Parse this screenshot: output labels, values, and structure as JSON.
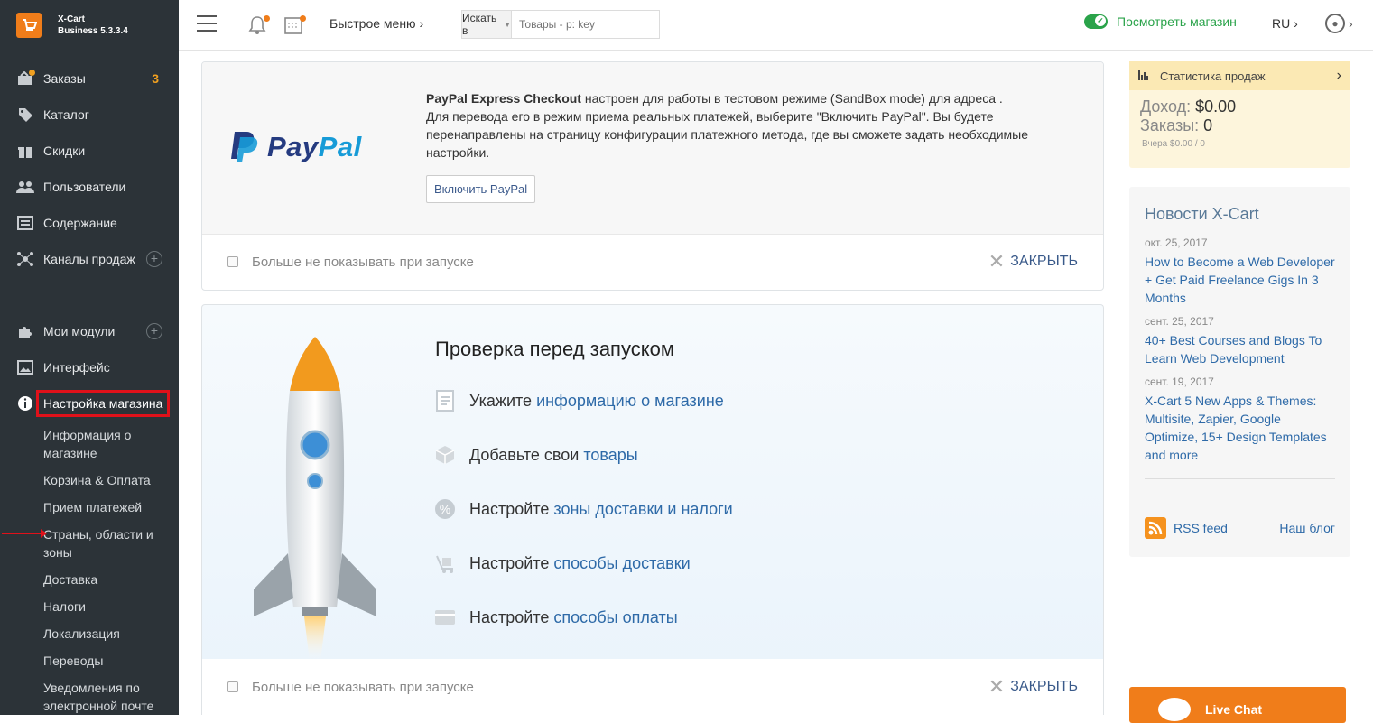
{
  "brand": {
    "name": "X-Cart",
    "edition": "Business 5.3.3.4"
  },
  "sidebar": {
    "items": [
      {
        "label": "Заказы",
        "badge": "3"
      },
      {
        "label": "Каталог"
      },
      {
        "label": "Скидки"
      },
      {
        "label": "Пользователи"
      },
      {
        "label": "Содержание"
      },
      {
        "label": "Каналы продаж"
      },
      {
        "label": "Мои модули"
      },
      {
        "label": "Интерфейс"
      },
      {
        "label": "Настройка магазина"
      }
    ],
    "subitems": [
      "Информация о магазине",
      "Корзина & Оплата",
      "Прием платежей",
      "Страны, области и зоны",
      "Доставка",
      "Налоги",
      "Локализация",
      "Переводы",
      "Уведомления по электронной почте"
    ]
  },
  "header": {
    "quick_menu": "Быстрое меню ›",
    "search_scope": "Искать в",
    "search_placeholder": "Товары - p: key",
    "view_store": "Посмотреть магазин",
    "lang": "RU ›"
  },
  "paypal": {
    "logo_pay": "Pay",
    "logo_pal": "Pal",
    "bold": "PayPal Express Checkout",
    "text": " настроен для работы в тестовом режиме (SandBox mode) для адреса .",
    "text2": "Для перевода его в режим приема реальных платежей, выберите \"Включить PayPal\". Вы будете перенаправлены на страницу конфигурации платежного метода, где вы сможете задать необходимые настройки.",
    "button": "Включить PayPal",
    "dont_show": "Больше не показывать при запуске",
    "close": "ЗАКРЫТЬ"
  },
  "launch": {
    "title": "Проверка перед запуском",
    "steps": [
      {
        "text": "Укажите",
        "link": "информацию о магазине"
      },
      {
        "text": "Добавьте свои",
        "link": "товары"
      },
      {
        "text": "Настройте",
        "link": "зоны доставки и налоги"
      },
      {
        "text": "Настройте",
        "link": "способы доставки"
      },
      {
        "text": "Настройте",
        "link": "способы оплаты"
      }
    ],
    "dont_show": "Больше не показывать при запуске",
    "close": "ЗАКРЫТЬ"
  },
  "stats": {
    "title": "Статистика продаж",
    "income_label": "Доход:",
    "income": "$0.00",
    "orders_label": "Заказы:",
    "orders": "0",
    "yesterday": "Вчера $0.00 / 0"
  },
  "news": {
    "title": "Новости X-Cart",
    "items": [
      {
        "date": "окт. 25, 2017",
        "title": "How to Become a Web Developer + Get Paid Freelance Gigs In 3 Months"
      },
      {
        "date": "сент. 25, 2017",
        "title": "40+ Best Courses and Blogs To Learn Web Development"
      },
      {
        "date": "сент. 19, 2017",
        "title": "X-Cart 5 New Apps & Themes: Multisite, Zapier, Google Optimize, 15+ Design Templates and more"
      }
    ],
    "rss": "RSS feed",
    "blog": "Наш блог"
  },
  "livechat": "Live Chat",
  "colors": {
    "sidebar": "#2c3338",
    "accent": "#f07d1a",
    "link": "#2e6aa8",
    "green": "#2aa34a",
    "highlight": "#e0111a"
  }
}
